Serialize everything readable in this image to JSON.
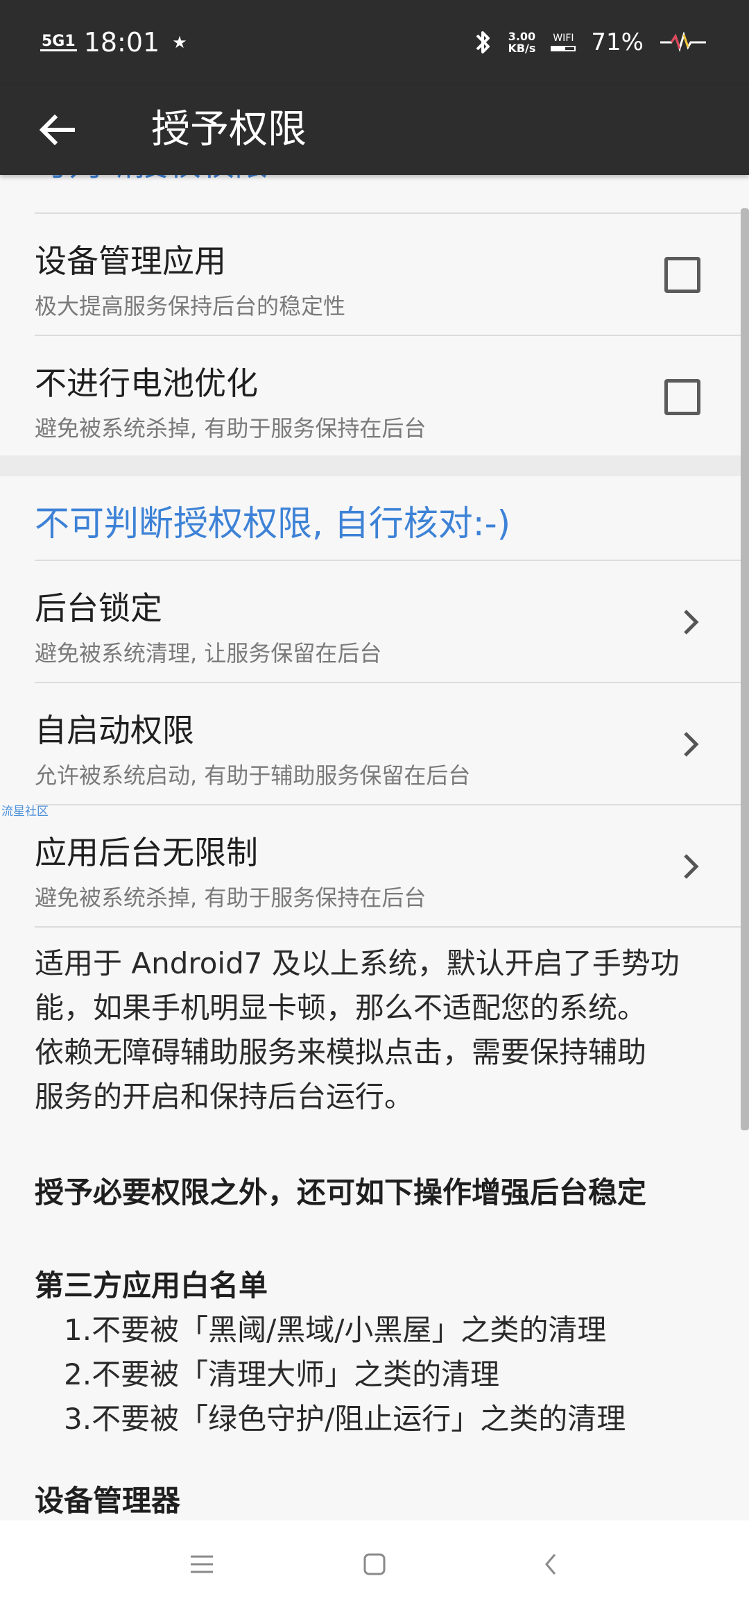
{
  "status_bar": {
    "network_badge": "5G1",
    "time": "18:01",
    "star": "★",
    "speed_value": "3.00",
    "speed_unit": "KB/s",
    "wifi_label": "WIFI",
    "battery": "71%"
  },
  "app_bar": {
    "back_icon": "arrow-left-icon",
    "title": "授予权限"
  },
  "determinable_section": {
    "header": "可判断授权权限",
    "items": [
      {
        "title": "设备管理应用",
        "subtitle": "极大提高服务保持后台的稳定性",
        "checked": false
      },
      {
        "title": "不进行电池优化",
        "subtitle": "避免被系统杀掉, 有助于服务保持在后台",
        "checked": false
      }
    ]
  },
  "undeterminable_section": {
    "header": "不可判断授权权限, 自行核对:-)",
    "items": [
      {
        "title": "后台锁定",
        "subtitle": "避免被系统清理, 让服务保留在后台"
      },
      {
        "title": "自启动权限",
        "subtitle": "允许被系统启动, 有助于辅助服务保留在后台"
      },
      {
        "title": "应用后台无限制",
        "subtitle": "避免被系统杀掉, 有助于服务保持在后台"
      }
    ]
  },
  "watermark": "流星社区",
  "description": {
    "lines": [
      "适用于 Android7 及以上系统，默认开启了手势功",
      "能，如果手机明显卡顿，那么不适配您的系统。",
      "依赖无障碍辅助服务来模拟点击，需要保持辅助",
      "服务的开启和保持后台运行。"
    ],
    "extra_heading": "授予必要权限之外，还可如下操作增强后台稳定",
    "whitelist_heading": "第三方应用白名单",
    "whitelist_items": [
      "1.不要被「黑阈/黑域/小黑屋」之类的清理",
      "2.不要被「清理大师」之类的清理",
      "3.不要被「绿色守护/阻止运行」之类的清理"
    ],
    "device_admin_heading": "设备管理器"
  },
  "nav_bar": {
    "menu_icon": "menu-icon",
    "home_icon": "home-square-icon",
    "back_icon": "back-chevron-icon"
  },
  "colors": {
    "bar_bg": "#2d2d2d",
    "accent": "#3d82d6",
    "page_bg": "#f7f7f8"
  }
}
